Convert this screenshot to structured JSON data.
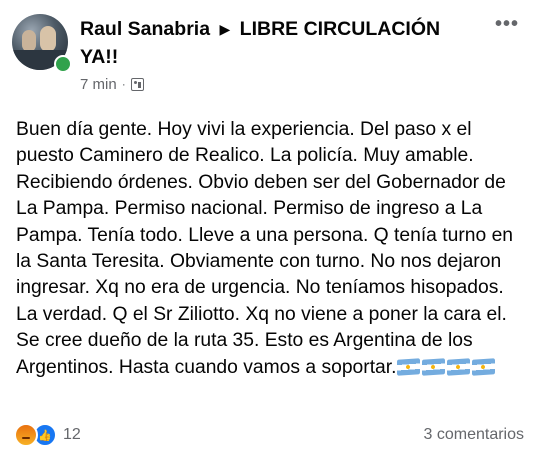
{
  "post": {
    "author": "Raul Sanabria",
    "separator_icon": "triangle-right-icon",
    "group": "LIBRE CIRCULACIÓN YA!!",
    "time": "7 min",
    "meta_separator": "·",
    "audience_icon": "group-audience-icon",
    "more_label": "•••",
    "text": "Buen día gente. Hoy vivi  la experiencia.  Del paso x el puesto Caminero de Realico. La policía. Muy amable. Recibiendo órdenes.  Obvio deben ser del Gobernador de La Pampa. Permiso nacional. Permiso de ingreso a La Pampa. Tenía todo.  Lleve a una persona.  Q tenía turno en la Santa Teresita. Obviamente con turno. No nos dejaron ingresar. Xq no era de urgencia. No teníamos hisopados. La verdad. Q el Sr Ziliotto. Xq no viene a poner la cara el. Se cree dueño de la ruta 35. Esto es Argentina de los Argentinos. Hasta cuando vamos a soportar.",
    "emoji_flags": 4,
    "reactions": {
      "types": [
        "angry",
        "like"
      ],
      "count": "12"
    },
    "comments": "3 comentarios"
  },
  "colors": {
    "text": "#050505",
    "secondary": "#65676b",
    "online": "#31a24c",
    "like_blue": "#1877f2",
    "flag_blue": "#74acdf"
  }
}
